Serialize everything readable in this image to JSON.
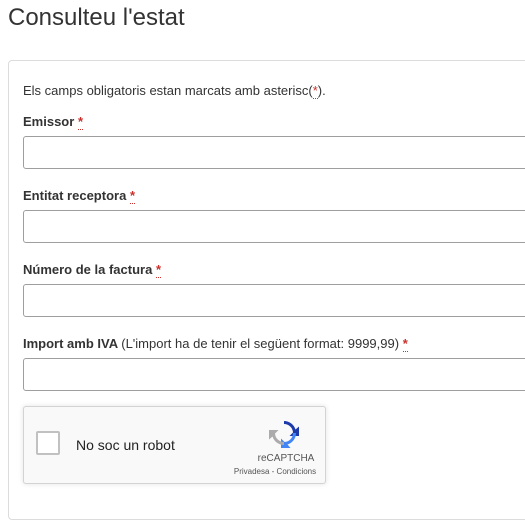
{
  "page": {
    "title": "Consulteu l'estat"
  },
  "form": {
    "intro_text": "Els camps obligatoris estan marcats amb asterisc(",
    "intro_star": "*",
    "intro_end": ").",
    "required_marker": "*",
    "fields": [
      {
        "label": "Emissor",
        "value": ""
      },
      {
        "label": "Entitat receptora",
        "value": ""
      },
      {
        "label": "Número de la factura",
        "value": ""
      },
      {
        "label": "Import amb IVA",
        "hint": "(L'import ha de tenir el següent format: 9999,99)",
        "value": ""
      }
    ]
  },
  "captcha": {
    "label": "No soc un robot",
    "brand": "reCAPTCHA",
    "privacy": "Privadesa",
    "separator": " - ",
    "terms": "Condicions",
    "logo_icon": "recaptcha-icon",
    "checkbox_checked": false
  },
  "colors": {
    "required": "#c9302c",
    "input_border": "#9e9e9e",
    "panel_border": "#dcdcdc"
  }
}
